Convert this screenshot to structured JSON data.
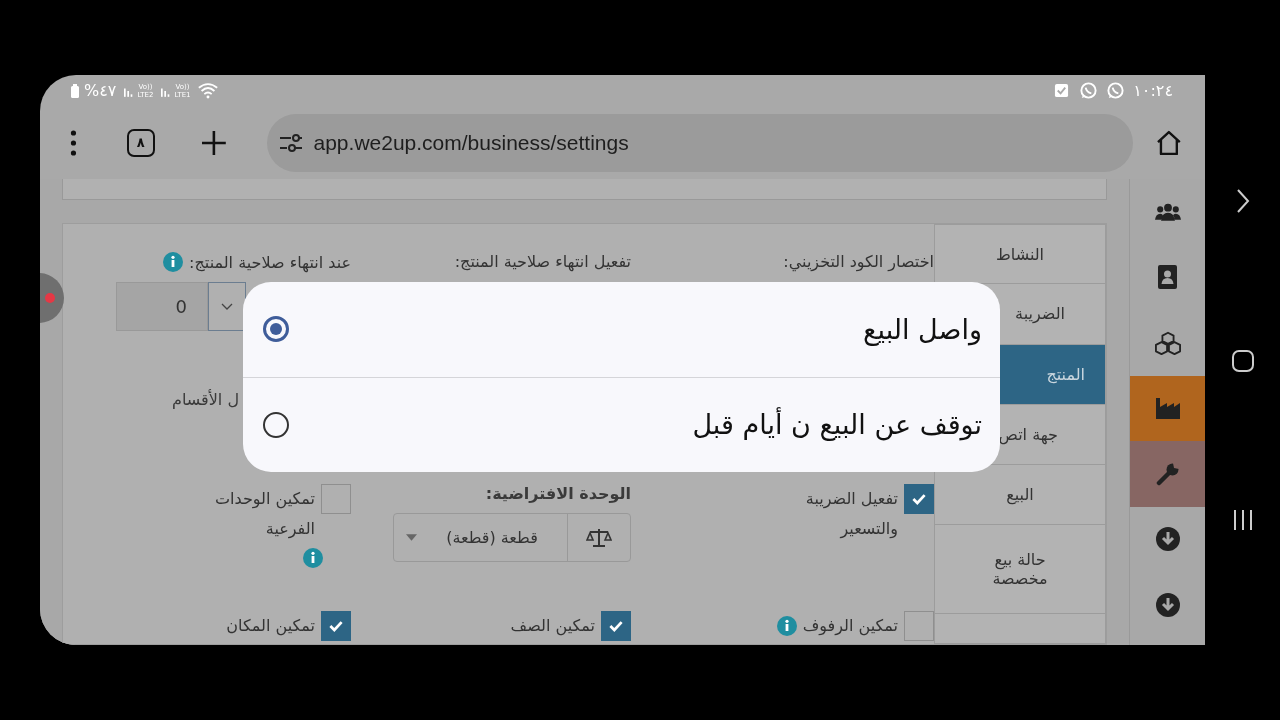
{
  "status_bar": {
    "battery": "%٤٧",
    "sims": [
      {
        "volte": "Vo))",
        "label": "LTE1"
      },
      {
        "volte": "Vo))",
        "label": "LTE2"
      }
    ],
    "time": "١٠:٢٤"
  },
  "browser": {
    "tab_count": "٨",
    "url": "app.we2up.com/business/settings"
  },
  "sidebar_icons": [
    {
      "kind": "people"
    },
    {
      "kind": "contacts"
    },
    {
      "kind": "cubes"
    },
    {
      "kind": "factory",
      "color": "#b0651e"
    },
    {
      "kind": "wrench",
      "color": "#876663"
    },
    {
      "kind": "download"
    },
    {
      "kind": "download"
    }
  ],
  "tabs": [
    {
      "label": "النشاط",
      "selected": false
    },
    {
      "label": "الضريبة",
      "selected": false
    },
    {
      "label": "المنتج",
      "selected": true
    },
    {
      "label": "جهة اتص",
      "selected": false
    },
    {
      "label": "البيع",
      "selected": false
    },
    {
      "label": "حالة بيع مخصصة",
      "selected": false
    }
  ],
  "form": {
    "sku_prefix_label": "اختصار الكود التخزيني:",
    "expiry_label": "تفعيل انتهاء صلاحية المنتج:",
    "on_expiry": {
      "label": "عند انتهاء صلاحية المنتج:",
      "info": true,
      "value": "0"
    },
    "categories_label": "ل الأقسام",
    "tax": {
      "label": "تفعيل الضريبة والتسعير",
      "checked": true
    },
    "default_unit": {
      "label": "الوحدة الافتراضية:",
      "value": "قطعة (قطعة)"
    },
    "sub_units": {
      "label": "تمكين الوحدات الفرعية",
      "checked": false,
      "info": true
    },
    "bottom_checks": [
      {
        "label": "تمكين الرفوف",
        "checked": false,
        "info": true
      },
      {
        "label": "تمكين الصف",
        "checked": true
      },
      {
        "label": "تمكين المكان",
        "checked": true
      }
    ]
  },
  "dialog": {
    "options": [
      {
        "label": "واصل البيع",
        "selected": true
      },
      {
        "label": "توقف عن البيع ن أيام قبل",
        "selected": false
      }
    ]
  }
}
